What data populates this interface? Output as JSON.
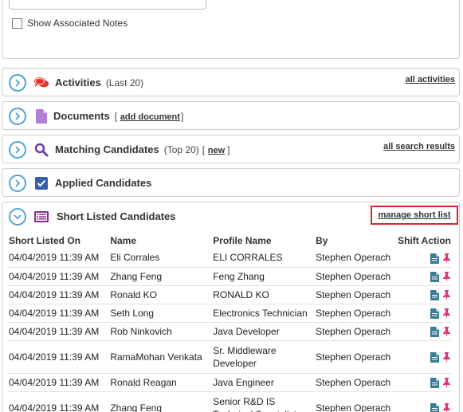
{
  "notes": {
    "label": "Show Associated Notes"
  },
  "sections": {
    "activities": {
      "title": "Activities",
      "sub": "(Last 20)",
      "link": "all activities"
    },
    "documents": {
      "title": "Documents",
      "bracket_open": "[",
      "link": "add document",
      "bracket_close": "]"
    },
    "matching": {
      "title": "Matching Candidates",
      "sub": "(Top 20)",
      "bracket_open": "[",
      "link": "new",
      "bracket_close": "]",
      "right_link": "all search results"
    },
    "applied": {
      "title": "Applied Candidates"
    },
    "shortlisted": {
      "title": "Short Listed Candidates",
      "link": "manage short list"
    }
  },
  "table": {
    "headers": [
      "Short Listed On",
      "Name",
      "Profile Name",
      "By",
      "Shift Action"
    ],
    "rows": [
      {
        "date": "04/04/2019 11:39 AM",
        "name": "Eli Corrales",
        "profile": "ELI CORRALES",
        "by": "Stephen Operach"
      },
      {
        "date": "04/04/2019 11:39 AM",
        "name": "Zhang Feng",
        "profile": "Feng Zhang",
        "by": "Stephen Operach"
      },
      {
        "date": "04/04/2019 11:39 AM",
        "name": "Ronald KO",
        "profile": "RONALD KO",
        "by": "Stephen Operach"
      },
      {
        "date": "04/04/2019 11:39 AM",
        "name": "Seth Long",
        "profile": "Electronics Technician",
        "by": "Stephen Operach"
      },
      {
        "date": "04/04/2019 11:39 AM",
        "name": "Rob Ninkovich",
        "profile": "Java Developer",
        "by": "Stephen Operach"
      },
      {
        "date": "04/04/2019 11:39 AM",
        "name": "RamaMohan Venkata",
        "profile": "Sr. Middleware Developer",
        "by": "Stephen Operach"
      },
      {
        "date": "04/04/2019 11:39 AM",
        "name": "Ronald Reagan",
        "profile": "Java Engineer",
        "by": "Stephen Operach"
      },
      {
        "date": "04/04/2019 11:39 AM",
        "name": "Zhang Feng",
        "profile": "Senior R&D IS Technical Specialist",
        "by": "Stephen Operach"
      }
    ]
  },
  "colors": {
    "expander": "#4fa3d6",
    "activities_icon": "#e0352b",
    "documents_icon": "#b27fd6",
    "matching_icon": "#6a3fa8",
    "applied_icon": "#3a5fa8",
    "shortlist_icon": "#8a2b8c",
    "doc_action": "#3a7d93",
    "pin_action": "#e0357a",
    "highlight": "#d9232d"
  }
}
